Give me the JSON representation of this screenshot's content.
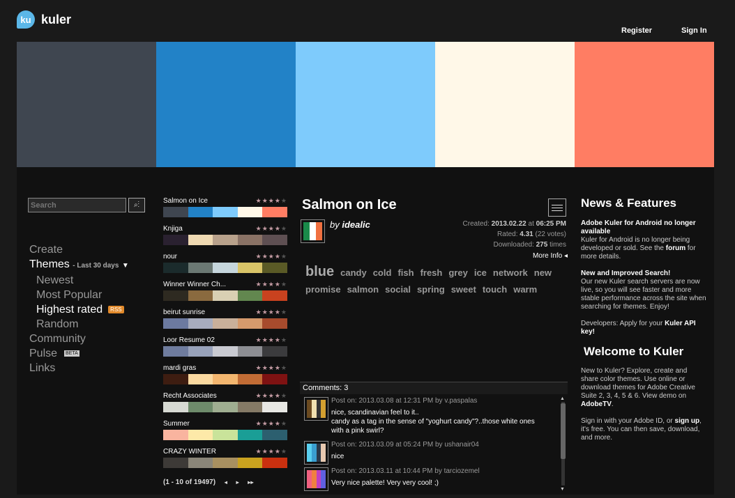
{
  "brand": {
    "badge": "ku",
    "name": "kuler"
  },
  "header": {
    "register": "Register",
    "signin": "Sign In"
  },
  "hero": {
    "colors": [
      "#3f4650",
      "#2282c7",
      "#7ecbfc",
      "#fff8e8",
      "#ff7d63"
    ]
  },
  "search": {
    "placeholder": "Search"
  },
  "nav": {
    "create": "Create",
    "themes": "Themes",
    "themes_filter": "- Last 30 days",
    "newest": "Newest",
    "most_popular": "Most Popular",
    "highest_rated": "Highest rated",
    "rss": "RSS",
    "random": "Random",
    "community": "Community",
    "pulse": "Pulse",
    "beta": "BETA",
    "links": "Links"
  },
  "theme_list": [
    {
      "name": "Salmon on Ice",
      "rating": 4,
      "colors": [
        "#3f4650",
        "#2282c7",
        "#7ecbfc",
        "#fff8e8",
        "#ff7d63"
      ]
    },
    {
      "name": "Knjiga",
      "rating": 4,
      "colors": [
        "#2a2130",
        "#efd9b2",
        "#b8a18b",
        "#8a7265",
        "#5e4f52"
      ]
    },
    {
      "name": "nour",
      "rating": 4,
      "colors": [
        "#1b2b2c",
        "#6b7873",
        "#c6d6dc",
        "#d9c468",
        "#5a5a26"
      ]
    },
    {
      "name": "Winner Winner Ch...",
      "rating": 4,
      "colors": [
        "#2e2a21",
        "#8a6a3f",
        "#d9d0b3",
        "#62874f",
        "#c9421f"
      ]
    },
    {
      "name": "beirut sunrise",
      "rating": 4,
      "colors": [
        "#6c7aa0",
        "#a7acbd",
        "#c9b09a",
        "#d59a6c",
        "#a74b2d"
      ]
    },
    {
      "name": "Loor Resume 02",
      "rating": 4,
      "colors": [
        "#6f7c9e",
        "#98a2ba",
        "#c9cad1",
        "#8d8e93",
        "#3b3b3d"
      ]
    },
    {
      "name": "mardi gras",
      "rating": 4,
      "colors": [
        "#3e1d11",
        "#fbd9a0",
        "#f3b66f",
        "#c26c35",
        "#7e1212"
      ]
    },
    {
      "name": "Recht Associates",
      "rating": 4,
      "colors": [
        "#d7dad3",
        "#6e8b6b",
        "#9fae91",
        "#857a66",
        "#e8e8e4"
      ]
    },
    {
      "name": "Summer",
      "rating": 4,
      "colors": [
        "#f9b49f",
        "#fde9a8",
        "#c9e39a",
        "#1a9e96",
        "#2c5f6f"
      ]
    },
    {
      "name": "CRAZY WINTER",
      "rating": 4,
      "colors": [
        "#3d3a37",
        "#8a8578",
        "#a89060",
        "#c9a21f",
        "#c9300f"
      ]
    }
  ],
  "pager": {
    "range": "(1 - 10 of 19497)",
    "prev": "◂",
    "next": "▸",
    "last": "▸▸"
  },
  "detail": {
    "title": "Salmon on Ice",
    "thumb_colors": [
      "#1a8a4a",
      "#ffffff",
      "#f07040"
    ],
    "by_label": "by",
    "author": "idealic",
    "created_label": "Created:",
    "created_date": "2013.02.22",
    "created_at": "at",
    "created_time": "06:25 PM",
    "rated_label": "Rated:",
    "rated_value": "4.31",
    "rated_votes": "(22 votes)",
    "downloaded_label": "Downloaded:",
    "downloaded_value": "275",
    "downloaded_unit": "times",
    "more_info": "More Info ◂"
  },
  "tags": [
    "blue",
    "candy",
    "cold",
    "fish",
    "fresh",
    "grey",
    "ice",
    "network",
    "new",
    "promise",
    "salmon",
    "social",
    "spring",
    "sweet",
    "touch",
    "warm"
  ],
  "comments": {
    "header": "Comments: 3",
    "items": [
      {
        "meta": "Post on: 2013.03.08 at 12:31 PM by v.paspalas",
        "lines": [
          "nice, scandinavian feel to it..",
          "candy as a tag in the sense of \"yoghurt candy\"?..those white ones",
          "with a pink swirl?"
        ],
        "colors": [
          "#6b4a20",
          "#f0e0b0",
          "#333",
          "#d4a030"
        ]
      },
      {
        "meta": "Post on: 2013.03.09 at 05:24 PM by ushanair04",
        "lines": [
          "nice"
        ],
        "colors": [
          "#5ad0f0",
          "#3a9fd0",
          "#2a3848",
          "#e8c9b0"
        ]
      },
      {
        "meta": "Post on: 2013.03.11 at 10:44 PM by tarciozemel",
        "lines": [
          "Very nice palette! Very very cool! ;)"
        ],
        "colors": [
          "#f06080",
          "#f08040",
          "#c040c0",
          "#6060e0"
        ]
      }
    ]
  },
  "news": {
    "title": "News & Features",
    "item1_title": "Adobe Kuler for Android no longer available",
    "item1_body": "Kuler for Android is no longer being developed or sold. See the",
    "item1_link": "forum",
    "item1_tail": "for more details.",
    "item2_title": "New and Improved Search!",
    "item2_body": "Our new Kuler search servers are now live, so you will see faster and more stable performance across the site when searching for themes.  Enjoy!",
    "item3_body": "Developers: Apply for your",
    "item3_link": "Kuler API key!",
    "welcome_title": "Welcome to Kuler",
    "welcome_body": "New to Kuler? Explore, create and share color themes. Use online or download themes for Adobe Creative Suite 2, 3, 4, 5 & 6. View demo on",
    "welcome_link": "AdobeTV",
    "welcome_end": ".",
    "signin_body": "Sign in with your Adobe ID, or",
    "signin_link": "sign up",
    "signin_tail": ", it's free. You can then save, download, and more."
  }
}
